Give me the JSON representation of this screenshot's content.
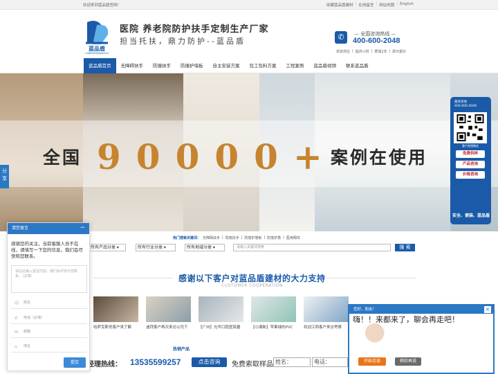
{
  "topbar": {
    "welcome": "欢迎来到蓝品盾官网！",
    "links": [
      "收藏蓝品盾建材",
      "在线留言",
      "网站地图",
      "English"
    ]
  },
  "header": {
    "logo_text": "蓝品盾",
    "logo_pinyin": "LANPINDUNJIANCAI",
    "slogan_line1": "医院  养老院防护扶手定制生产厂家",
    "slogan_line2": "担当托扶，鼎力防护--蓝品盾",
    "hotline_label": "全国咨询热线",
    "hotline_number": "400-600-2048",
    "quick_links": [
      "现货供应",
      "提供小样",
      "质保2年",
      "即日报价"
    ]
  },
  "nav": {
    "items": [
      "蓝品盾首页",
      "无障碍扶手",
      "防撞扶手",
      "防撞护墙板",
      "自主安装方案",
      "包工包料方案",
      "工程案例",
      "蓝品盾视频",
      "联系蓝品盾"
    ],
    "active": "蓝品盾首页"
  },
  "banner": {
    "prefix": "全国",
    "number": "90000+",
    "suffix": "案例在使用"
  },
  "float_service": {
    "title": "服务热线",
    "number": "400-600-2048",
    "qr_caption": "客户经理微信",
    "buttons": [
      "免费供样",
      "产品咨询",
      "价格咨询"
    ],
    "footer": "安全、便装、蓝品盾"
  },
  "share_tab": "分享",
  "search": {
    "hot_label": "热门搜索关键词：",
    "hot_keywords": [
      "无障碍扶手",
      "防撞扶手",
      "防撞护墙板",
      "防撞护角",
      "医用隔帘"
    ],
    "selects": [
      "所有产品分类",
      "所有行业分类",
      "所有地域分类"
    ],
    "placeholder": "请输入关键词搜索",
    "button": "搜 索"
  },
  "cooperation": {
    "title": "感谢以下客户对蓝品盾建材的大力支持",
    "subtitle": "CUSTOMER COOPERATION",
    "cases": [
      "哈萨克斯坦客户来了解",
      "迪拜客户再次来访公司下",
      "【广州】光华口腔医院量",
      "【小满新】苹果绿的PVC",
      "欢迎江西客户来访考察"
    ]
  },
  "products_label": "热销产品",
  "bottom_bar": {
    "hotline_label": "户经理热线：",
    "hotline_number": "13535599257",
    "consult_button": "点击咨询",
    "sample_label": "免费索取样品",
    "name_label": "姓名：",
    "phone_label": "电话："
  },
  "message_box": {
    "title": "请您留言",
    "minimize": "−",
    "intro": "感谢您的关注，当前客服人员不在线，请填写一下您的信息，我们会尽快和您联系。",
    "textarea_placeholder": "请在此输入留言内容，我们会尽快与您联系。（必填）",
    "fields": [
      "姓名",
      "电话（必填）",
      "邮箱",
      "地址"
    ],
    "submit": "提交"
  },
  "chat": {
    "title": "您好，朋友！",
    "close": "×",
    "message": "嗨！！来都来了，聊会再走吧！",
    "start_button": "开始交谈",
    "later_button": "稍后再说"
  },
  "colors": {
    "brand_blue": "#1a5aa8",
    "banner_gold": "#c6842f",
    "accent_red": "#c0252c"
  }
}
